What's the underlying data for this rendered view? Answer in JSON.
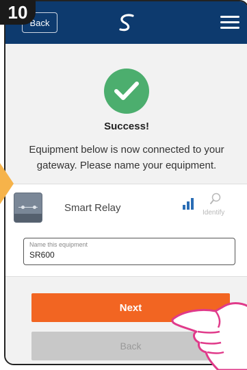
{
  "step_number": "10",
  "header": {
    "back_label": "Back",
    "logo_icon": "salus-logo-icon",
    "menu_icon": "hamburger-menu-icon",
    "background_color": "#0d3a6e"
  },
  "status": {
    "icon": "check-circle-icon",
    "title": "Success!",
    "message": "Equipment below is now connected to your gateway. Please name your equipment."
  },
  "device": {
    "icon": "smart-relay-icon",
    "name": "Smart Relay",
    "signal_icon": "signal-strength-icon",
    "identify_icon": "identify-icon",
    "identify_label": "Identify"
  },
  "name_field": {
    "label": "Name this equipment",
    "value": "SR600"
  },
  "actions": {
    "next_label": "Next",
    "back_label": "Back",
    "next_color": "#f26522"
  },
  "overlay": {
    "pointer_icon": "pointing-hand-icon",
    "arrow_color": "#f6b34a"
  }
}
